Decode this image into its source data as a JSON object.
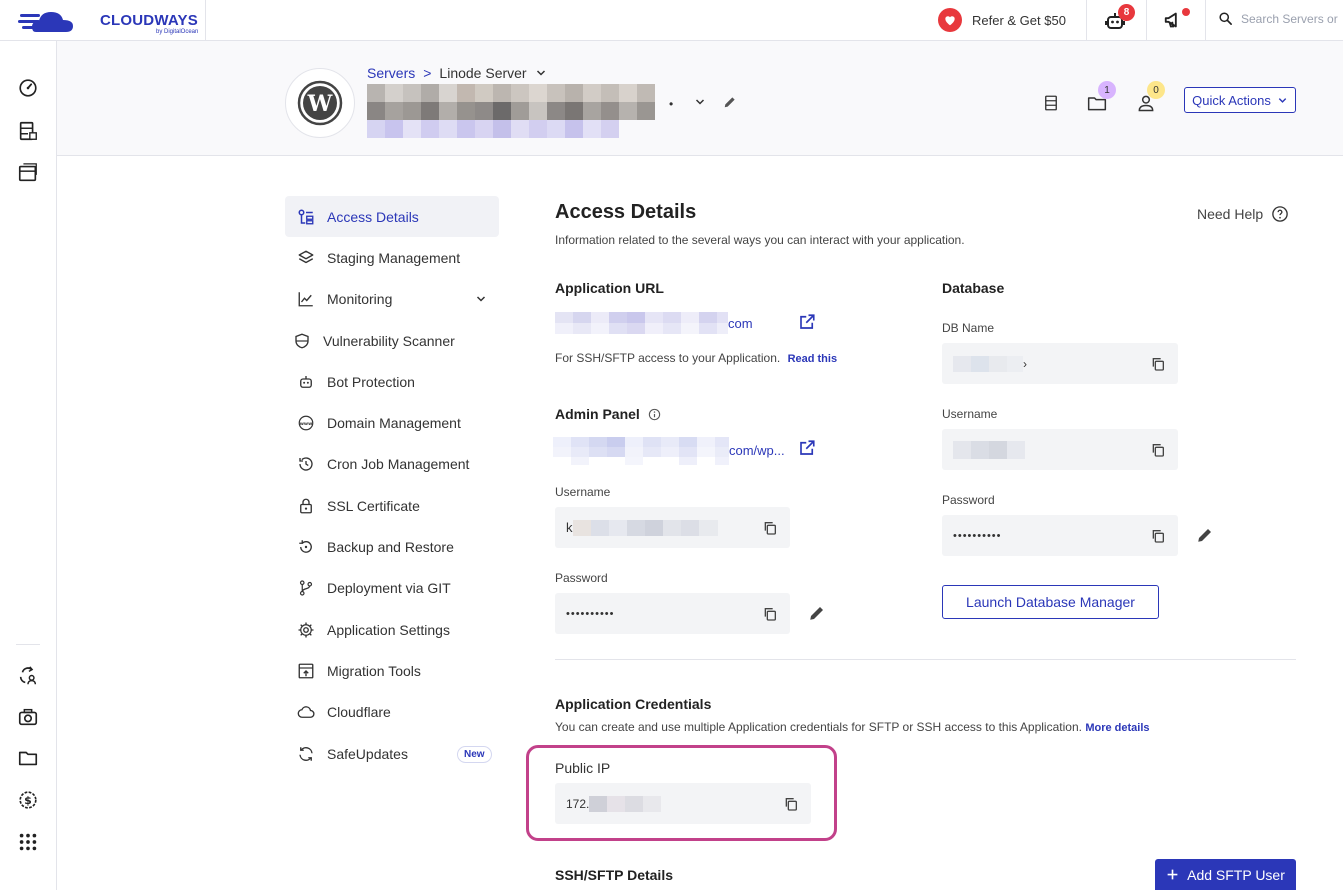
{
  "brand": {
    "name": "CLOUDWAYS",
    "byline": "by DigitalOcean",
    "color": "#2b37b8"
  },
  "topbar": {
    "refer_label": "Refer & Get $50",
    "bot_badge": "8",
    "search_placeholder": "Search Servers or"
  },
  "rail": {
    "icons": [
      "dashboard-icon",
      "servers-icon",
      "applications-icon",
      "team-icon",
      "addons-icon",
      "projects-icon",
      "billing-icon",
      "apps-grid-icon"
    ]
  },
  "header": {
    "breadcrumb_root": "Servers",
    "breadcrumb_sep": ">",
    "server_name": "Linode Server",
    "app_name_tail": "•",
    "projects_badge": "1",
    "team_badge": "0",
    "quick_actions_label": "Quick Actions"
  },
  "menu": {
    "items": [
      {
        "label": "Access Details",
        "icon": "access-details-icon",
        "active": true
      },
      {
        "label": "Staging Management",
        "icon": "layers-icon"
      },
      {
        "label": "Monitoring",
        "icon": "chart-line-icon",
        "expandable": true
      },
      {
        "label": "Vulnerability Scanner",
        "icon": "shield-scan-icon"
      },
      {
        "label": "Bot Protection",
        "icon": "robot-icon"
      },
      {
        "label": "Domain Management",
        "icon": "www-icon"
      },
      {
        "label": "Cron Job Management",
        "icon": "history-icon"
      },
      {
        "label": "SSL Certificate",
        "icon": "lock-icon"
      },
      {
        "label": "Backup and Restore",
        "icon": "restore-icon"
      },
      {
        "label": "Deployment via GIT",
        "icon": "git-branch-icon"
      },
      {
        "label": "Application Settings",
        "icon": "gear-icon"
      },
      {
        "label": "Migration Tools",
        "icon": "migration-icon"
      },
      {
        "label": "Cloudflare",
        "icon": "cloud-icon"
      },
      {
        "label": "SafeUpdates",
        "icon": "refresh-icon",
        "badge": "New"
      }
    ]
  },
  "main": {
    "title": "Access Details",
    "subtitle": "Information related to the several ways you can interact with your application.",
    "need_help": "Need Help",
    "app_url": {
      "title": "Application URL",
      "suffix": "com",
      "ssh_note": "For SSH/SFTP access to your Application.",
      "read_this": "Read this"
    },
    "admin_panel": {
      "title": "Admin Panel",
      "suffix": "com/wp...",
      "username_label": "Username",
      "username_prefix": "k",
      "password_label": "Password",
      "password_mask": "••••••••••"
    },
    "database": {
      "title": "Database",
      "db_name_label": "DB Name",
      "db_name_tail": "›",
      "username_label": "Username",
      "password_label": "Password",
      "password_mask": "••••••••••",
      "launch_label": "Launch Database Manager"
    },
    "credentials": {
      "title": "Application Credentials",
      "description": "You can create and use multiple Application credentials for SFTP or SSH access to this Application.",
      "more_details": "More details",
      "public_ip_label": "Public IP",
      "public_ip_prefix": "172."
    },
    "sftp": {
      "title": "SSH/SFTP Details",
      "add_label": "Add SFTP User"
    }
  },
  "colors": {
    "accent": "#2b37b8",
    "highlight": "#c2418a",
    "badge_red": "#e8383d"
  }
}
